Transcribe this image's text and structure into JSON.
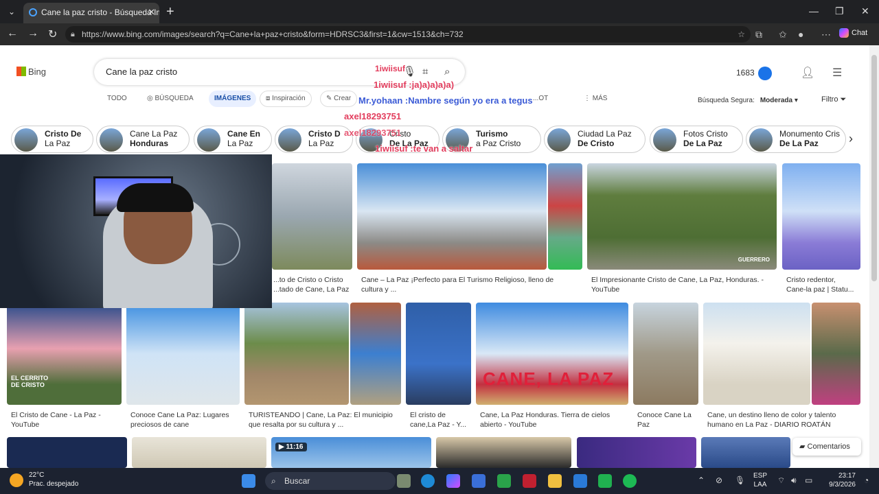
{
  "browser": {
    "tab_title": "Cane la paz cristo - Búsqueda Imá",
    "url": "https://www.bing.com/images/search?q=Cane+la+paz+cristo&form=HDRSC3&first=1&cw=1513&ch=732",
    "chat_label": "Chat"
  },
  "bing": {
    "logo": "Bing",
    "query": "Cane la paz cristo",
    "points": "1683",
    "scopes": [
      "TODO",
      "BÚSQUEDA",
      "IMÁGENES",
      "Inspiración",
      "Crear",
      "MÁS"
    ],
    "scope_partial_1": "...OT",
    "safe_label": "Búsqueda Segura:",
    "safe_value": "Moderada",
    "filter_label": "Filtro",
    "comments_label": "Comentarios"
  },
  "chips": [
    {
      "a": "Cristo De",
      "b": "La Paz",
      "bbold": false
    },
    {
      "a": "Cane La Paz",
      "b": "Honduras",
      "bbold": true
    },
    {
      "a": "Cane En",
      "b": "La Paz",
      "bbold": false
    },
    {
      "a": "Cristo D",
      "b": "La Paz",
      "bbold": false
    },
    {
      "a": "Cristo",
      "b": "De La Paz",
      "bbold": true
    },
    {
      "a": "Turismo",
      "b": "a Paz Cristo",
      "bbold": false
    },
    {
      "a": "Ciudad La Paz",
      "b": "De Cristo",
      "bbold": true
    },
    {
      "a": "Fotos Cristo",
      "b": "De La Paz",
      "bbold": true
    },
    {
      "a": "Monumento Cris",
      "b": "De La Paz",
      "bbold": true
    }
  ],
  "results_row1": [
    "...to de Cristo o Cristo\n...tado de Cane, La Paz",
    "Cane – La Paz ¡Perfecto para El Turismo Religioso, lleno de\ncultura y ...",
    "El Impresionante Cristo de Cane, La Paz, Honduras. -\nYouTube",
    "Cristo redentor,\nCane-la paz | Statu..."
  ],
  "results_row2": [
    "El Cristo de Cane - La Paz -\nYouTube",
    "Conoce Cane La Paz: Lugares\npreciosos de cane",
    "TURISTEANDO | Cane, La Paz: El municipio\nque resalta por su cultura y ...",
    "El cristo de\ncane,La Paz - Y...",
    "Cane, La Paz Honduras. Tierra de cielos\nabierto - YouTube",
    "Conoce Cane La\nPaz",
    "Cane, un destino lleno de color y talento\nhumano en La Paz - DIARIO ROATÁN"
  ],
  "image_text": {
    "derrito": "EL CERRITO\nDE CRISTO",
    "cane_sign": "CANE, LA PAZ",
    "video_duration": "▶ 11:16",
    "guerrero": "GUERRERO"
  },
  "overlay_chat": [
    {
      "text": "1iwiisuf",
      "style": "red"
    },
    {
      "text": "1iwiisuf :ja)a)a)a)a)",
      "style": "red"
    },
    {
      "text": "Mr.yohaan :Nambre según yo era a tegus",
      "style": "blue"
    },
    {
      "text": "axel18293751",
      "style": "red"
    },
    {
      "text": "axel18293751",
      "style": "red"
    },
    {
      "text": "1iwiisuf :te van a saltar",
      "style": "red"
    }
  ],
  "taskbar": {
    "temp": "22°C",
    "weather": "Prac. despejado",
    "search": "Buscar",
    "lang1": "ESP",
    "lang2": "LAA",
    "time": "23:17",
    "date": "9/3/2026"
  },
  "colors": {
    "accent_blue": "#174ea6",
    "chat_red": "#e23c5c",
    "chat_blue": "#3b5bd6",
    "taskbar": "#1c2230"
  }
}
